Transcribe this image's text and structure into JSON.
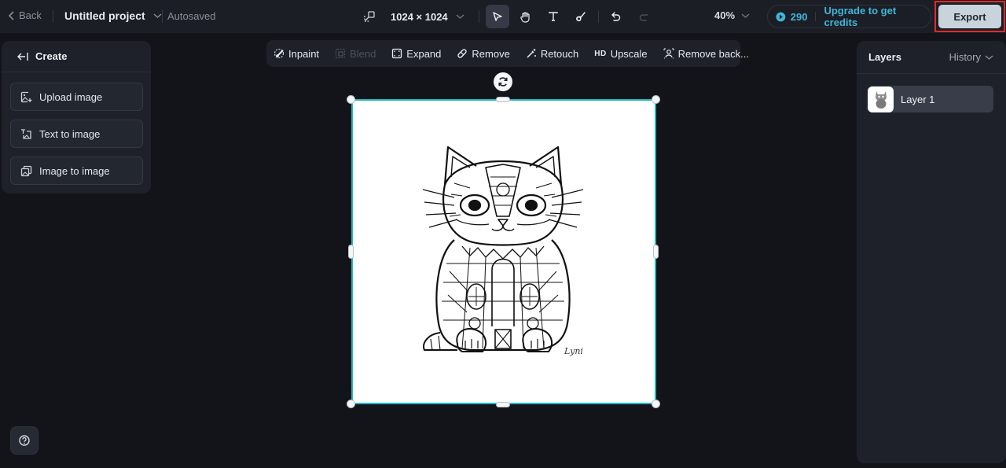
{
  "topbar": {
    "back_label": "Back",
    "project_title": "Untitled project",
    "save_status": "Autosaved",
    "canvas_size": "1024 × 1024",
    "tools": [
      {
        "name": "select",
        "icon": "pointer-icon",
        "active": true
      },
      {
        "name": "pan",
        "icon": "hand-icon",
        "active": false
      },
      {
        "name": "text",
        "icon": "text-icon",
        "active": false
      },
      {
        "name": "brush",
        "icon": "brush-icon",
        "active": false
      }
    ],
    "undo_enabled": true,
    "redo_enabled": false,
    "zoom_level": "40%",
    "credits_count": "290",
    "upgrade_label": "Upgrade to get credits",
    "export_label": "Export"
  },
  "edit_toolbar": {
    "items": [
      {
        "label": "Inpaint",
        "icon": "inpaint-icon",
        "enabled": true
      },
      {
        "label": "Blend",
        "icon": "blend-icon",
        "enabled": false
      },
      {
        "label": "Expand",
        "icon": "expand-icon",
        "enabled": true
      },
      {
        "label": "Remove",
        "icon": "eraser-icon",
        "enabled": true
      },
      {
        "label": "Retouch",
        "icon": "retouch-wand-icon",
        "enabled": true
      },
      {
        "label": "Upscale",
        "icon": "hd-icon",
        "icon_text": "HD",
        "enabled": true
      },
      {
        "label": "Remove back...",
        "icon": "remove-background-icon",
        "enabled": true
      }
    ]
  },
  "left_panel": {
    "header": "Create",
    "buttons": [
      {
        "label": "Upload image",
        "icon": "upload-image-icon"
      },
      {
        "label": "Text to image",
        "icon": "text-to-image-icon"
      },
      {
        "label": "Image to image",
        "icon": "image-to-image-icon"
      }
    ]
  },
  "right_panel": {
    "title": "Layers",
    "history_label": "History",
    "layers": [
      {
        "name": "Layer 1",
        "selected": true
      }
    ]
  },
  "canvas": {
    "content": "Mandala-style cat coloring page line art",
    "signature": "Lyni",
    "selection_color": "#1fb8c1"
  },
  "colors": {
    "accent": "#3fb7da",
    "selection": "#1fb8c1",
    "export_bg": "#c9d3dc",
    "highlight_border": "#e02a2a"
  }
}
